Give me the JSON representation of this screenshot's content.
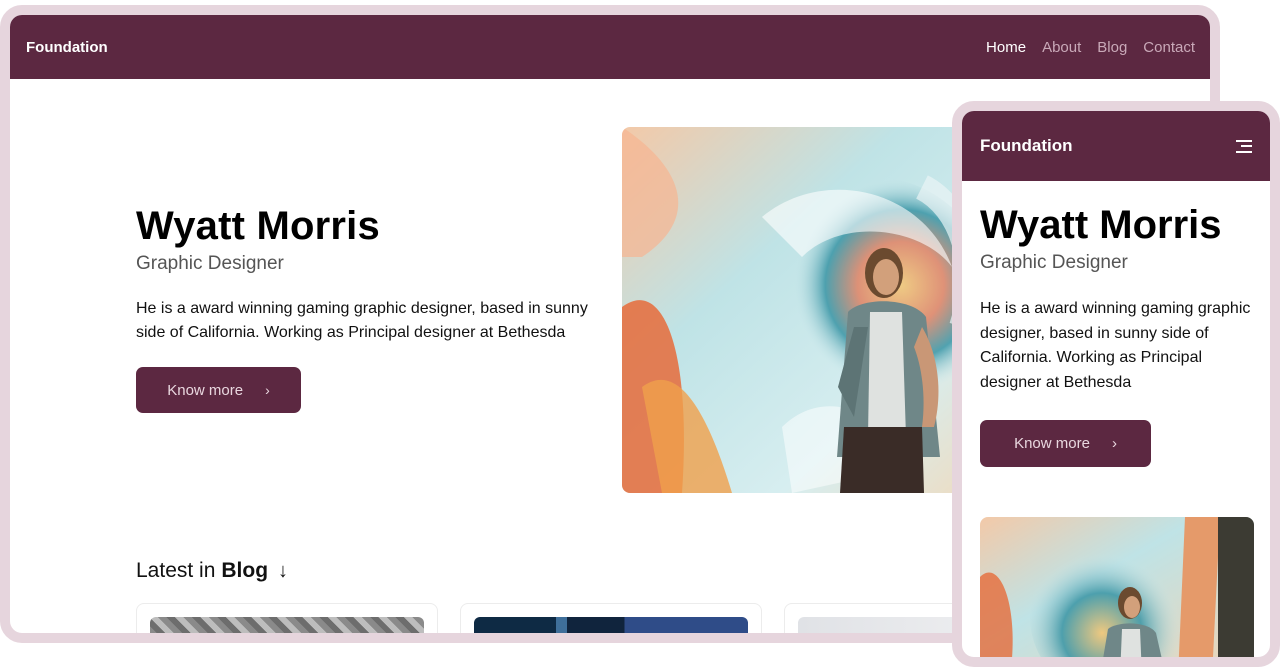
{
  "desktop": {
    "brand": "Foundation",
    "nav": [
      {
        "label": "Home",
        "active": true
      },
      {
        "label": "About",
        "active": false
      },
      {
        "label": "Blog",
        "active": false
      },
      {
        "label": "Contact",
        "active": false
      }
    ],
    "hero": {
      "name": "Wyatt Morris",
      "role": "Graphic Designer",
      "description": "He is a award winning gaming graphic designer, based in sunny side of California. Working as Principal designer at Bethesda",
      "cta_label": "Know more",
      "cta_icon": "chevron-right-icon"
    },
    "blog": {
      "prefix": "Latest in",
      "emphasis": "Blog",
      "icon": "arrow-down-icon"
    }
  },
  "mobile": {
    "brand": "Foundation",
    "menu_icon": "menu-icon",
    "hero": {
      "name": "Wyatt Morris",
      "role": "Graphic Designer",
      "description": "He is a award winning gaming graphic designer, based in sunny side of California. Working as Principal designer at Bethesda",
      "cta_label": "Know more",
      "cta_icon": "chevron-right-icon"
    }
  },
  "colors": {
    "brand": "#5c2841",
    "frame": "#e6d5dd",
    "nav_inactive": "#c9a9b8"
  }
}
